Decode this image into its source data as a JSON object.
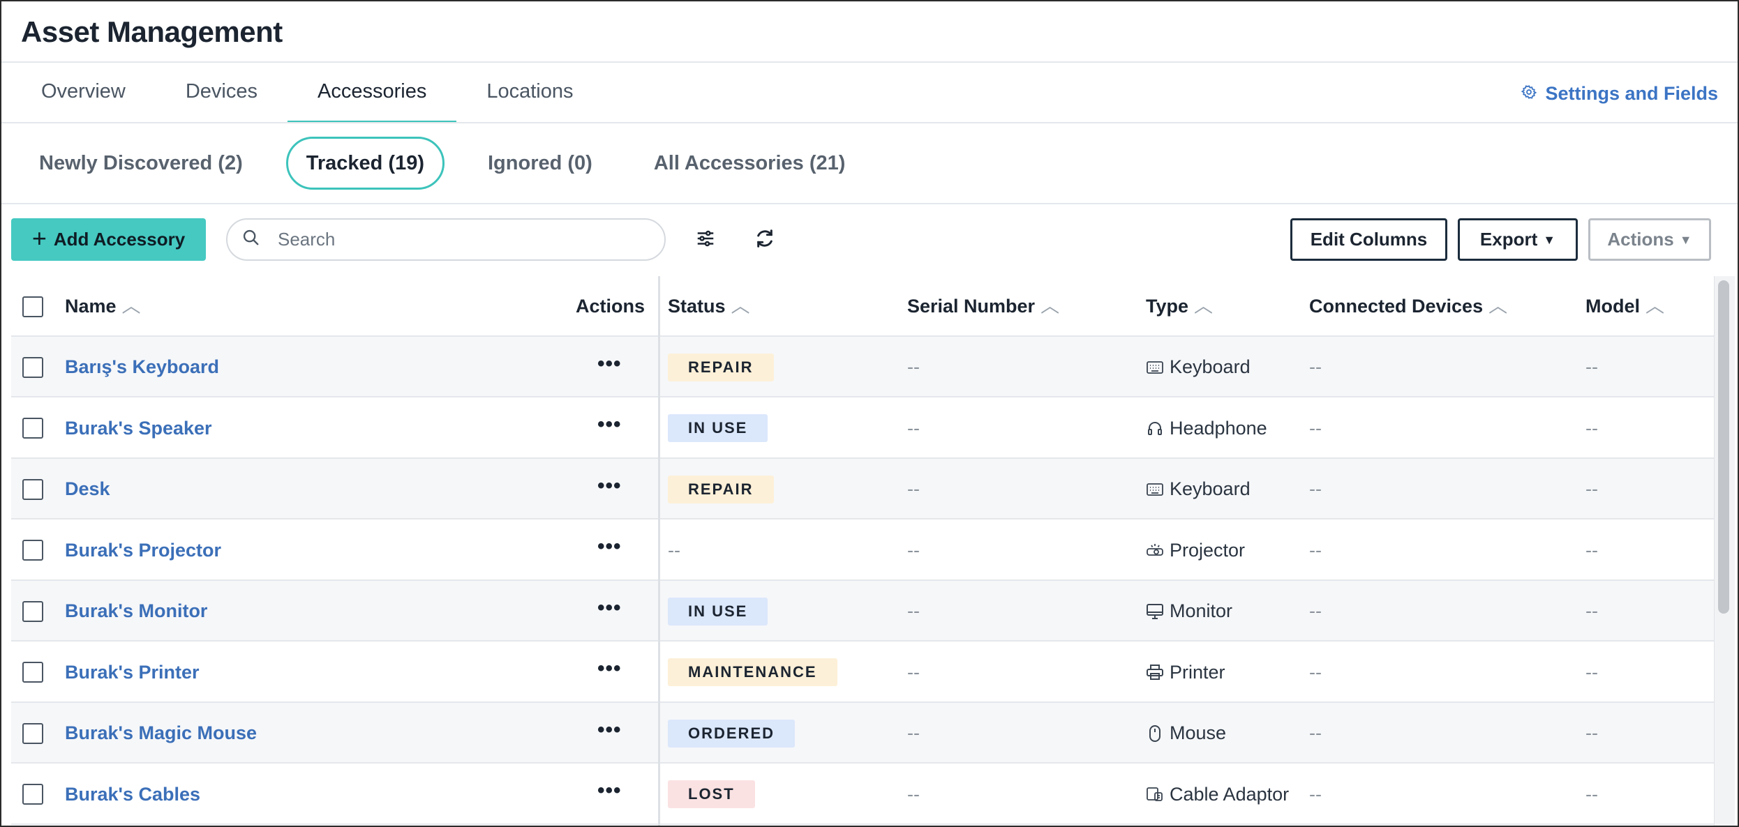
{
  "header": {
    "title": "Asset Management"
  },
  "main_tabs": [
    {
      "label": "Overview",
      "active": false
    },
    {
      "label": "Devices",
      "active": false
    },
    {
      "label": "Accessories",
      "active": true
    },
    {
      "label": "Locations",
      "active": false
    }
  ],
  "settings_link": {
    "label": "Settings and Fields",
    "icon": "gear-icon"
  },
  "sub_tabs": [
    {
      "label": "Newly Discovered (2)",
      "active": false
    },
    {
      "label": "Tracked (19)",
      "active": true
    },
    {
      "label": "Ignored (0)",
      "active": false
    },
    {
      "label": "All Accessories (21)",
      "active": false
    }
  ],
  "toolbar": {
    "add_label": "Add Accessory",
    "search_placeholder": "Search",
    "search_value": "",
    "filter_icon": "sliders-icon",
    "refresh_icon": "refresh-icon",
    "edit_columns_label": "Edit Columns",
    "export_label": "Export",
    "actions_label": "Actions"
  },
  "table": {
    "columns": {
      "name": "Name",
      "actions": "Actions",
      "status": "Status",
      "serial": "Serial Number",
      "type": "Type",
      "connected": "Connected Devices",
      "model": "Model"
    },
    "actions_glyph": "•••",
    "rows": [
      {
        "name": "Barış's Keyboard",
        "status": "REPAIR",
        "status_kind": "repair",
        "serial": "--",
        "type": "Keyboard",
        "type_icon": "keyboard-icon",
        "connected": "--",
        "model": "--"
      },
      {
        "name": "Burak's Speaker",
        "status": "IN USE",
        "status_kind": "inuse",
        "serial": "--",
        "type": "Headphone",
        "type_icon": "headphone-icon",
        "connected": "--",
        "model": "--"
      },
      {
        "name": "Desk",
        "status": "REPAIR",
        "status_kind": "repair",
        "serial": "--",
        "type": "Keyboard",
        "type_icon": "keyboard-icon",
        "connected": "--",
        "model": "--"
      },
      {
        "name": "Burak's Projector",
        "status": "--",
        "status_kind": "none",
        "serial": "--",
        "type": "Projector",
        "type_icon": "projector-icon",
        "connected": "--",
        "model": "--"
      },
      {
        "name": "Burak's Monitor",
        "status": "IN USE",
        "status_kind": "inuse",
        "serial": "--",
        "type": "Monitor",
        "type_icon": "monitor-icon",
        "connected": "--",
        "model": "--"
      },
      {
        "name": "Burak's Printer",
        "status": "MAINTENANCE",
        "status_kind": "maintenance",
        "serial": "--",
        "type": "Printer",
        "type_icon": "printer-icon",
        "connected": "--",
        "model": "--"
      },
      {
        "name": "Burak's Magic Mouse",
        "status": "ORDERED",
        "status_kind": "ordered",
        "serial": "--",
        "type": "Mouse",
        "type_icon": "mouse-icon",
        "connected": "--",
        "model": "--"
      },
      {
        "name": "Burak's Cables",
        "status": "LOST",
        "status_kind": "lost",
        "serial": "--",
        "type": "Cable Adaptor",
        "type_icon": "cable-adaptor-icon",
        "connected": "--",
        "model": "--"
      }
    ]
  }
}
